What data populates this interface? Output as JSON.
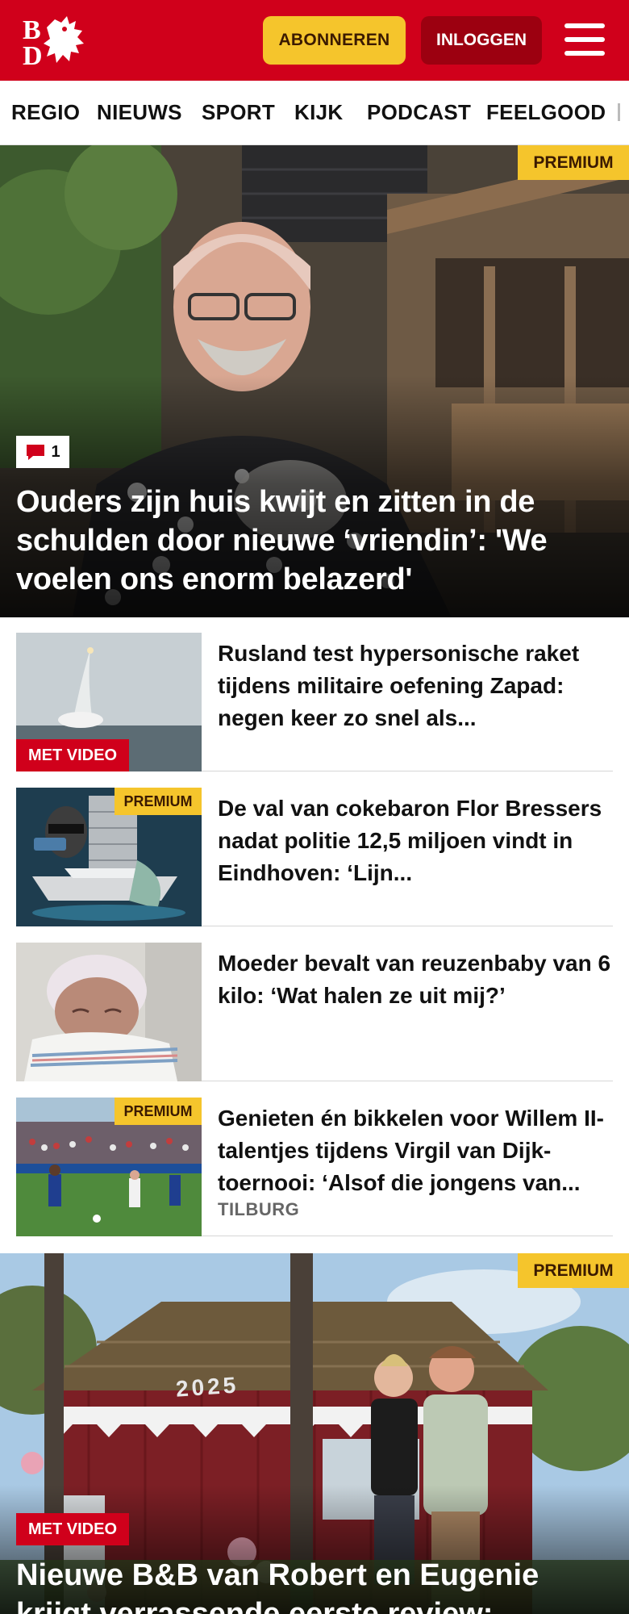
{
  "header": {
    "logo_text": "BD",
    "subscribe_label": "ABONNEREN",
    "login_label": "INLOGGEN"
  },
  "nav": {
    "items": [
      "REGIO",
      "NIEUWS",
      "SPORT",
      "KIJK",
      "PODCAST",
      "FEELGOOD"
    ]
  },
  "hero": {
    "premium_label": "PREMIUM",
    "comment_count": "1",
    "title": "Ouders zijn huis kwijt en zitten in de schulden door nieuwe ‘vriendin’: 'We voelen ons enorm belazerd'"
  },
  "articles": [
    {
      "title": "Rusland test hypersonische raket tijdens militaire oefening Zapad: negen keer zo snel als...",
      "tag": "MET VIDEO",
      "image": "rocket-launch"
    },
    {
      "title": "De val van cokebaron Flor Bressers nadat politie 12,5 miljoen vindt in Eindhoven: ‘Lijn...",
      "tag": "PREMIUM",
      "image": "collage-yacht"
    },
    {
      "title": "Moeder bevalt van reuzenbaby van 6 kilo: ‘Wat halen ze uit mij?’",
      "tag": "",
      "image": "newborn-baby"
    },
    {
      "title": "Genieten én bikkelen voor Willem II-talentjes tijdens Virgil van Dijk-toernooi: ‘Alsof die jongens van...",
      "tag": "PREMIUM",
      "location": "TILBURG",
      "image": "football-match"
    }
  ],
  "hero2": {
    "premium_label": "PREMIUM",
    "tag": "MET VIDEO",
    "house_number": "2025",
    "title": "Nieuwe B&B van Robert en Eugenie krijgt verrassende eerste review:"
  },
  "colors": {
    "brand_red": "#d0001b",
    "premium_yellow": "#f5c52c",
    "login_dark_red": "#9c0010"
  }
}
